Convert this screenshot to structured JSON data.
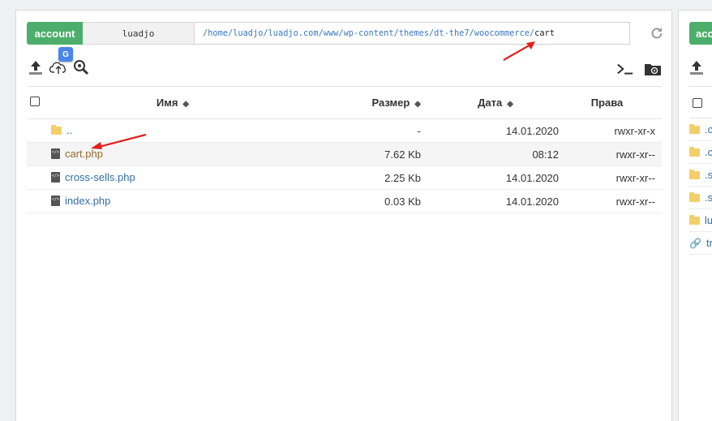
{
  "main": {
    "account_label": "account",
    "username": "luadjo",
    "path_link": "/home/luadjo/luadjo.com/www/wp-content/themes/dt-the7/woocommerce/",
    "path_current": "cart",
    "translate_badge": "G",
    "columns": {
      "name": "Имя",
      "size": "Размер",
      "date": "Дата",
      "perms": "Права"
    },
    "rows": [
      {
        "name": "..",
        "size": "-",
        "date": "14.01.2020",
        "perms": "rwxr-xr-x"
      },
      {
        "name": "cart.php",
        "size": "7.62 Kb",
        "date": "08:12",
        "perms": "rwxr-xr--"
      },
      {
        "name": "cross-sells.php",
        "size": "2.25 Kb",
        "date": "14.01.2020",
        "perms": "rwxr-xr--"
      },
      {
        "name": "index.php",
        "size": "0.03 Kb",
        "date": "14.01.2020",
        "perms": "rwxr-xr--"
      }
    ]
  },
  "side": {
    "account_label": "account",
    "rows": [
      ".c",
      ".c",
      ".s",
      ".s",
      "lu",
      "tr"
    ]
  },
  "colors": {
    "account_green": "#4cae6a",
    "link_blue": "#2f6ea8",
    "selected_link": "#9a6a2e",
    "arrow_red": "#e02020"
  }
}
